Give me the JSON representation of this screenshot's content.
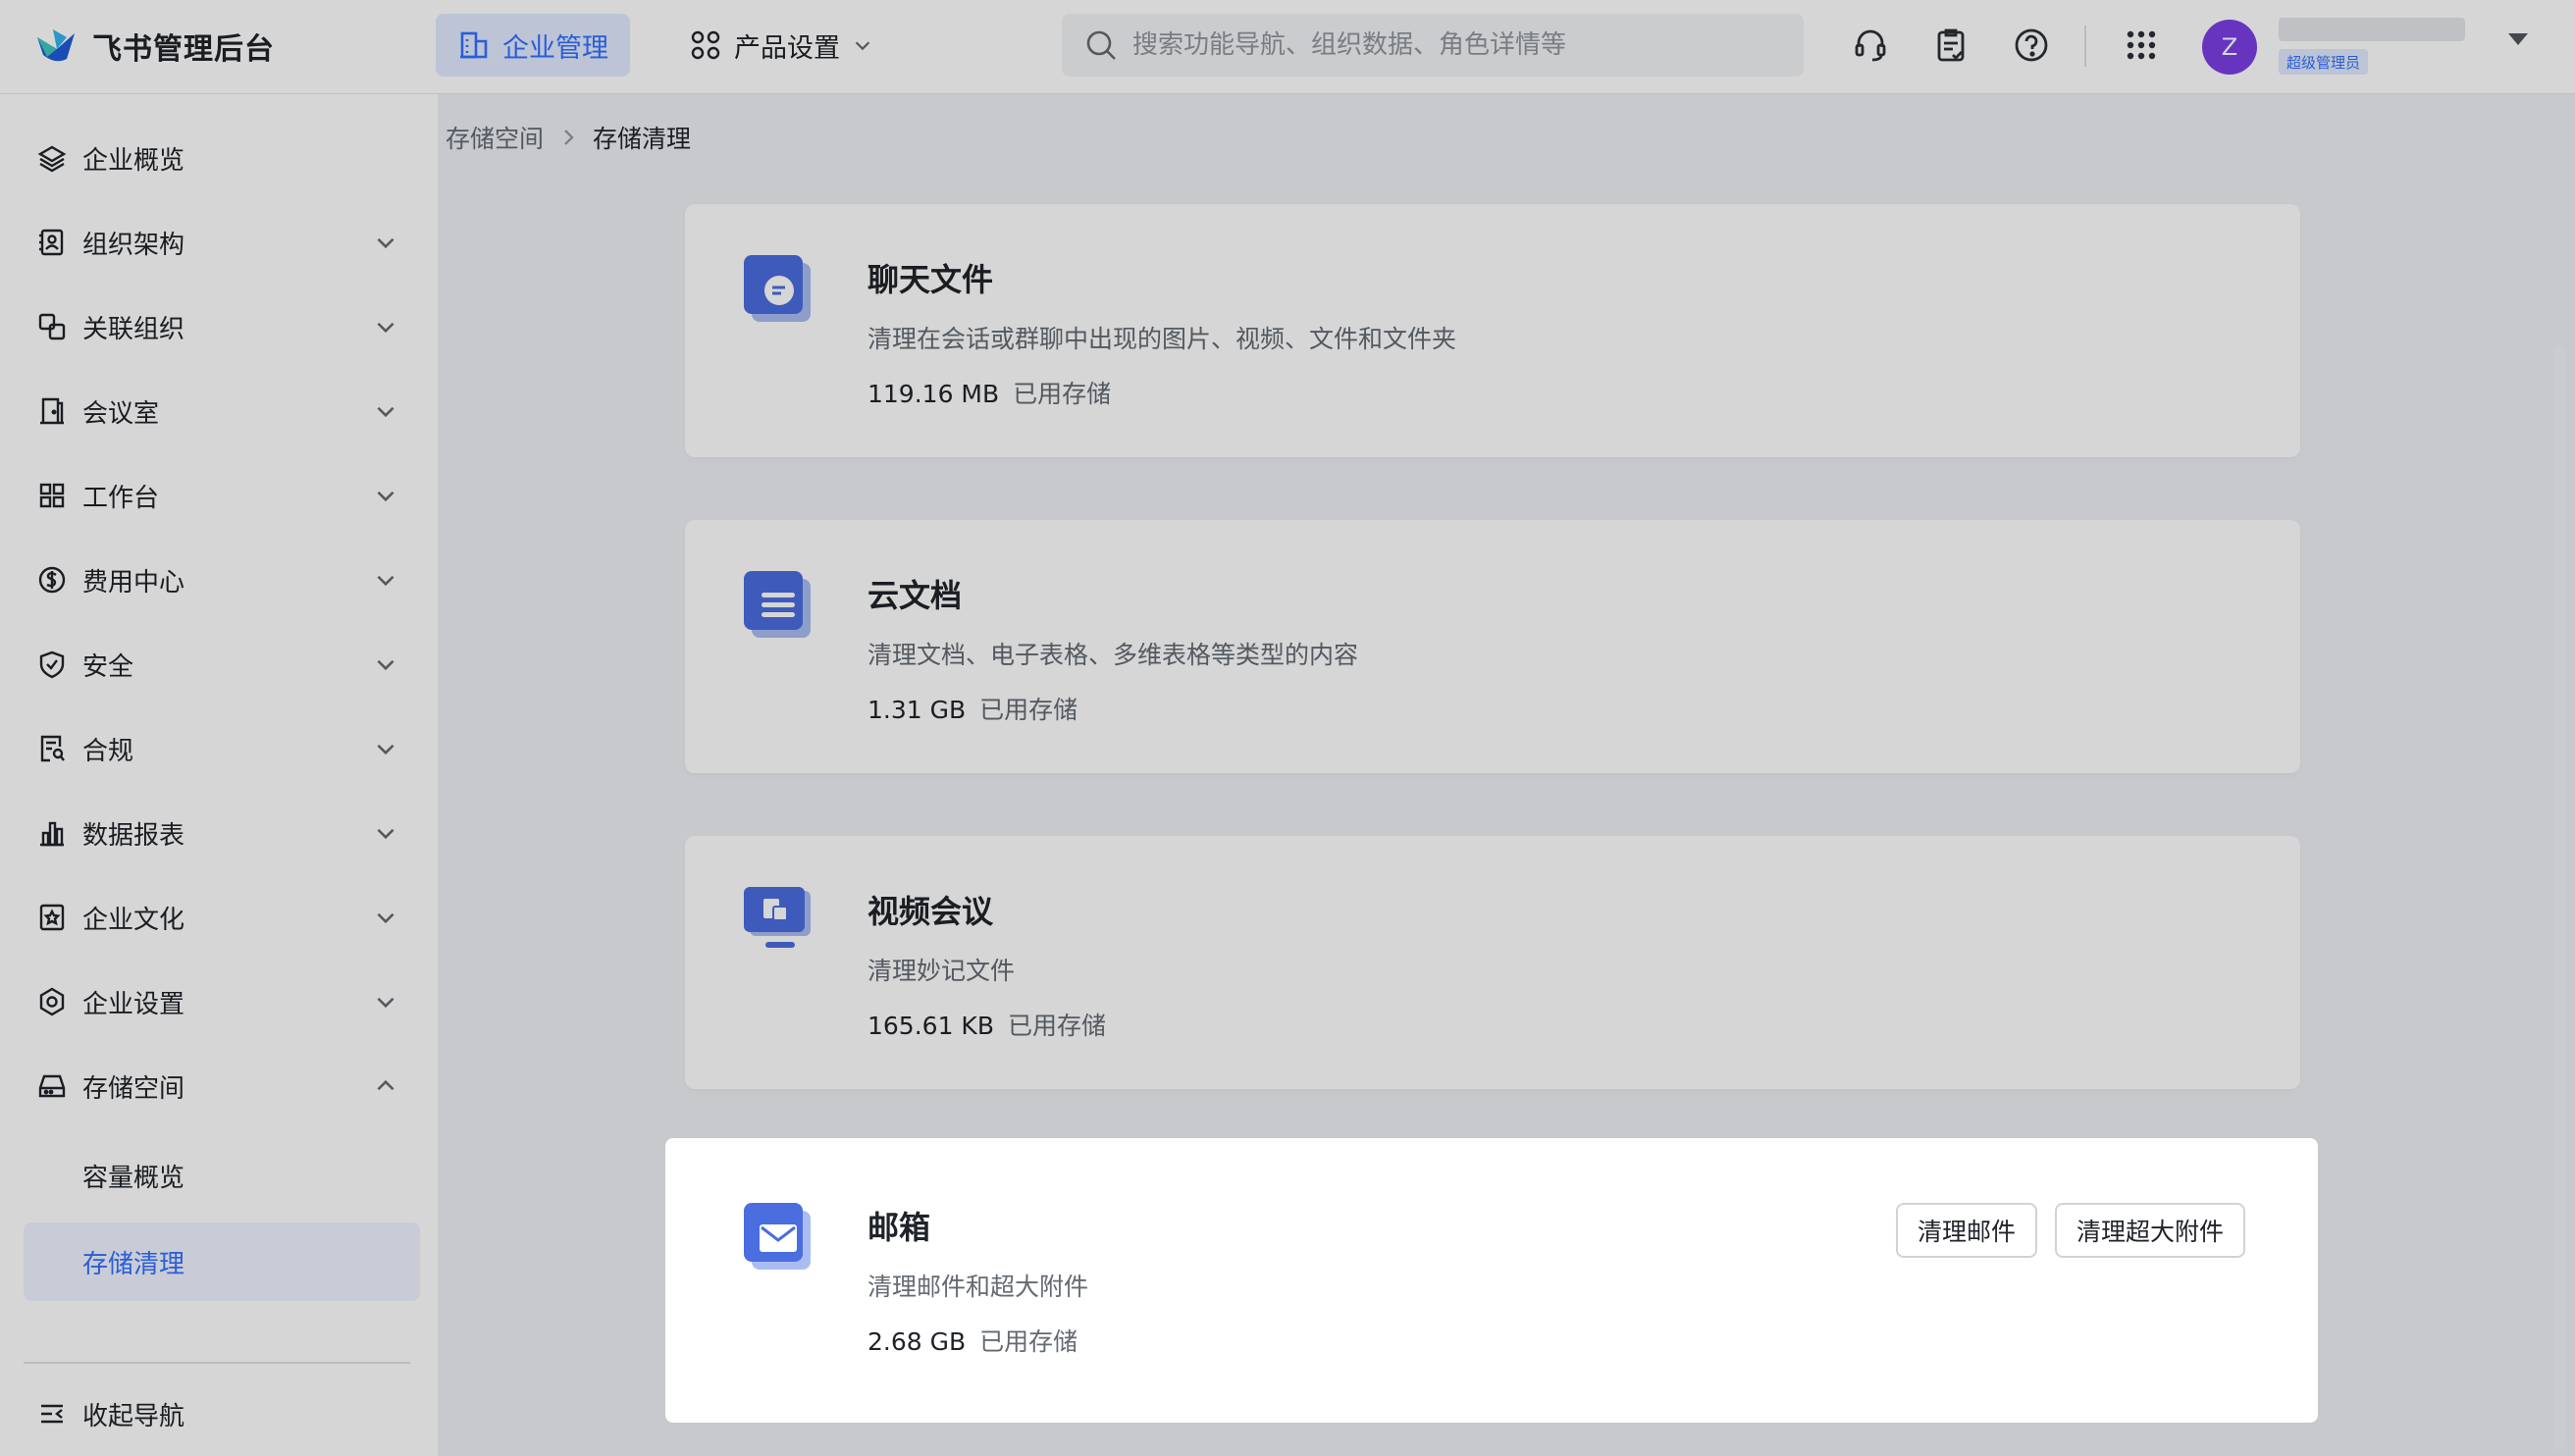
{
  "colors": {
    "brand": "#3370ff",
    "avatar": "#7b3fe4",
    "active_bg": "#e1eaff"
  },
  "topbar": {
    "app_name": "飞书管理后台",
    "tabs": [
      {
        "label": "企业管理",
        "icon": "building-icon",
        "active": true
      },
      {
        "label": "产品设置",
        "icon": "apps-icon",
        "active": false
      }
    ],
    "search_placeholder": "搜索功能导航、组织数据、角色详情等",
    "avatar_letter": "Z",
    "admin_badge": "超级管理员"
  },
  "sidebar": {
    "items": [
      {
        "label": "企业概览",
        "icon": "layers-icon"
      },
      {
        "label": "组织架构",
        "icon": "org-icon"
      },
      {
        "label": "关联组织",
        "icon": "link-org-icon"
      },
      {
        "label": "会议室",
        "icon": "door-icon"
      },
      {
        "label": "工作台",
        "icon": "grid-icon"
      },
      {
        "label": "费用中心",
        "icon": "dollar-icon"
      },
      {
        "label": "安全",
        "icon": "shield-icon"
      },
      {
        "label": "合规",
        "icon": "compliance-icon"
      },
      {
        "label": "数据报表",
        "icon": "bar-chart-icon"
      },
      {
        "label": "企业文化",
        "icon": "culture-icon"
      },
      {
        "label": "企业设置",
        "icon": "gear-icon"
      },
      {
        "label": "存储空间",
        "icon": "storage-icon"
      }
    ],
    "sub_items": [
      {
        "label": "容量概览",
        "active": false
      },
      {
        "label": "存储清理",
        "active": true
      }
    ],
    "collapse_label": "收起导航"
  },
  "breadcrumb": {
    "parent": "存储空间",
    "current": "存储清理"
  },
  "cards": [
    {
      "title": "聊天文件",
      "desc": "清理在会话或群聊中出现的图片、视频、文件和文件夹",
      "size": "119.16 MB",
      "used": "已用存储",
      "icon": "chat-file-icon"
    },
    {
      "title": "云文档",
      "desc": "清理文档、电子表格、多维表格等类型的内容",
      "size": "1.31 GB",
      "used": "已用存储",
      "icon": "cloud-doc-icon"
    },
    {
      "title": "视频会议",
      "desc": "清理妙记文件",
      "size": "165.61 KB",
      "used": "已用存储",
      "icon": "video-meeting-icon"
    },
    {
      "title": "邮箱",
      "desc": "清理邮件和超大附件",
      "size": "2.68 GB",
      "used": "已用存储",
      "icon": "mail-icon",
      "buttons": [
        "清理邮件",
        "清理超大附件"
      ]
    }
  ]
}
